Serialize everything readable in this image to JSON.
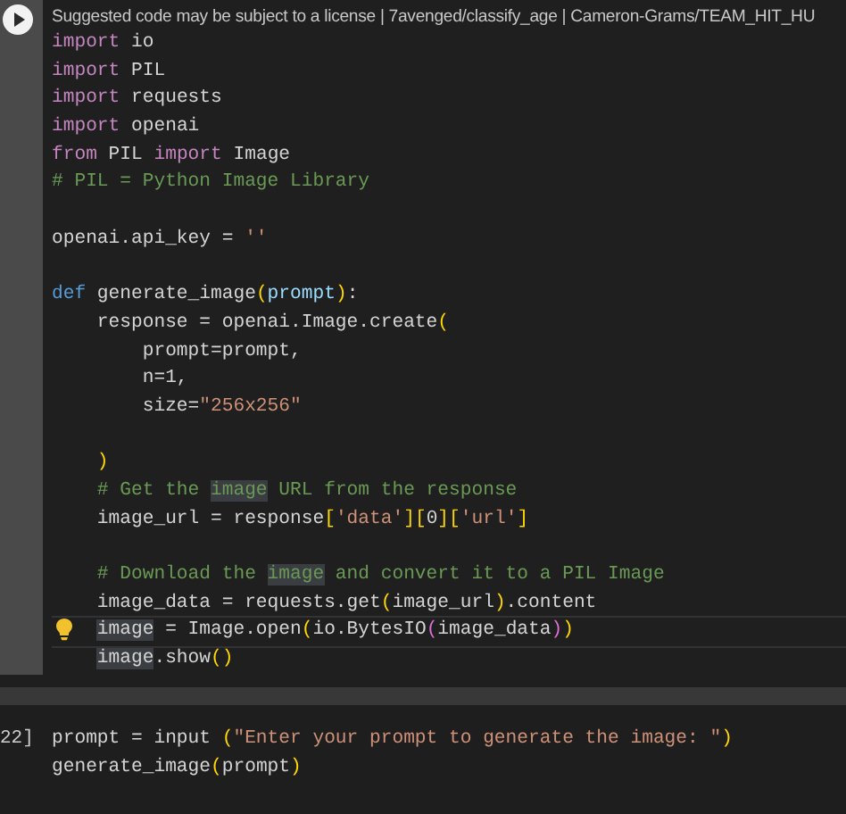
{
  "cells": [
    {
      "kind": "active",
      "notice": "Suggested code may be subject to a license | 7avenged/classify_age | Cameron-Grams/TEAM_HIT_HU",
      "lines": [
        {
          "kind": "code",
          "current": false,
          "tokens": [
            {
              "kind": "keyword",
              "text": "import"
            },
            {
              "kind": "plain",
              "text": " io"
            }
          ]
        },
        {
          "kind": "code",
          "current": false,
          "tokens": [
            {
              "kind": "keyword",
              "text": "import"
            },
            {
              "kind": "plain",
              "text": " PIL"
            }
          ]
        },
        {
          "kind": "code",
          "current": false,
          "tokens": [
            {
              "kind": "keyword",
              "text": "import"
            },
            {
              "kind": "plain",
              "text": " requests"
            }
          ]
        },
        {
          "kind": "code",
          "current": false,
          "tokens": [
            {
              "kind": "keyword",
              "text": "import"
            },
            {
              "kind": "plain",
              "text": " openai"
            }
          ]
        },
        {
          "kind": "code",
          "current": false,
          "tokens": [
            {
              "kind": "keyword",
              "text": "from"
            },
            {
              "kind": "plain",
              "text": " PIL "
            },
            {
              "kind": "keyword",
              "text": "import"
            },
            {
              "kind": "plain",
              "text": " Image"
            }
          ]
        },
        {
          "kind": "code",
          "current": false,
          "tokens": [
            {
              "kind": "comment",
              "text": "# PIL = Python Image Library"
            }
          ]
        },
        {
          "kind": "blank"
        },
        {
          "kind": "code",
          "current": false,
          "tokens": [
            {
              "kind": "plain",
              "text": "openai.api_key = "
            },
            {
              "kind": "string",
              "text": "''"
            }
          ]
        },
        {
          "kind": "blank"
        },
        {
          "kind": "code",
          "current": false,
          "tokens": [
            {
              "kind": "def",
              "text": "def"
            },
            {
              "kind": "plain",
              "text": " generate_image"
            },
            {
              "kind": "bracket",
              "text": "("
            },
            {
              "kind": "param",
              "text": "prompt"
            },
            {
              "kind": "bracket",
              "text": ")"
            },
            {
              "kind": "plain",
              "text": ":"
            }
          ]
        },
        {
          "kind": "code",
          "indented": true,
          "current": false,
          "tokens": [
            {
              "kind": "plain",
              "text": "response = openai.Image.create"
            },
            {
              "kind": "bracket",
              "text": "("
            }
          ]
        },
        {
          "kind": "code",
          "indented": true,
          "current": false,
          "tokens": [
            {
              "kind": "plain",
              "text": "    prompt=prompt,"
            }
          ]
        },
        {
          "kind": "code",
          "indented": true,
          "current": false,
          "tokens": [
            {
              "kind": "plain",
              "text": "    n=1,"
            }
          ]
        },
        {
          "kind": "code",
          "indented": true,
          "current": false,
          "tokens": [
            {
              "kind": "plain",
              "text": "    size="
            },
            {
              "kind": "string",
              "text": "\"256x256\""
            }
          ]
        },
        {
          "kind": "blank"
        },
        {
          "kind": "code",
          "indented": true,
          "current": false,
          "tokens": [
            {
              "kind": "bracket",
              "text": ")"
            }
          ]
        },
        {
          "kind": "code",
          "indented": true,
          "current": false,
          "tokens": [
            {
              "kind": "comment",
              "text": "# Get the "
            },
            {
              "kind": "comment-match",
              "text": "image"
            },
            {
              "kind": "comment",
              "text": " URL from the response"
            }
          ]
        },
        {
          "kind": "code",
          "indented": true,
          "current": false,
          "tokens": [
            {
              "kind": "plain",
              "text": "image_url = response"
            },
            {
              "kind": "bracket",
              "text": "["
            },
            {
              "kind": "string",
              "text": "'data'"
            },
            {
              "kind": "bracket",
              "text": "]["
            },
            {
              "kind": "plain",
              "text": "0"
            },
            {
              "kind": "bracket",
              "text": "]["
            },
            {
              "kind": "string",
              "text": "'url'"
            },
            {
              "kind": "bracket",
              "text": "]"
            }
          ]
        },
        {
          "kind": "blank"
        },
        {
          "kind": "code",
          "indented": true,
          "current": false,
          "tokens": [
            {
              "kind": "comment",
              "text": "# Download the "
            },
            {
              "kind": "comment-match",
              "text": "image"
            },
            {
              "kind": "comment",
              "text": " and convert it to a PIL Image"
            }
          ]
        },
        {
          "kind": "code",
          "indented": true,
          "current": false,
          "tokens": [
            {
              "kind": "plain",
              "text": "image_data = requests.get"
            },
            {
              "kind": "bracket",
              "text": "("
            },
            {
              "kind": "plain",
              "text": "image_url"
            },
            {
              "kind": "bracket",
              "text": ")"
            },
            {
              "kind": "plain",
              "text": ".content"
            }
          ]
        },
        {
          "kind": "code",
          "indented": true,
          "current": true,
          "tokens": [
            {
              "kind": "match",
              "text": "image"
            },
            {
              "kind": "plain",
              "text": " = Image.open"
            },
            {
              "kind": "bracket",
              "text": "("
            },
            {
              "kind": "plain",
              "text": "io.BytesIO"
            },
            {
              "kind": "bracket2",
              "text": "("
            },
            {
              "kind": "plain",
              "text": "image_data"
            },
            {
              "kind": "bracket2",
              "text": ")"
            },
            {
              "kind": "bracket",
              "text": ")"
            }
          ]
        },
        {
          "kind": "code",
          "indented": true,
          "current": false,
          "tokens": [
            {
              "kind": "match",
              "text": "image"
            },
            {
              "kind": "plain",
              "text": ".show"
            },
            {
              "kind": "bracket",
              "text": "()"
            }
          ]
        }
      ]
    },
    {
      "kind": "idle",
      "count": "22]",
      "lines": [
        {
          "kind": "code",
          "current": false,
          "tokens": [
            {
              "kind": "plain",
              "text": "prompt = input "
            },
            {
              "kind": "bracket",
              "text": "("
            },
            {
              "kind": "string",
              "text": "\"Enter your prompt to generate the image: \""
            },
            {
              "kind": "bracket",
              "text": ")"
            }
          ]
        },
        {
          "kind": "code",
          "current": false,
          "tokens": [
            {
              "kind": "plain",
              "text": "generate_image"
            },
            {
              "kind": "bracket",
              "text": "("
            },
            {
              "kind": "plain",
              "text": "prompt"
            },
            {
              "kind": "bracket",
              "text": ")"
            }
          ]
        }
      ]
    }
  ]
}
